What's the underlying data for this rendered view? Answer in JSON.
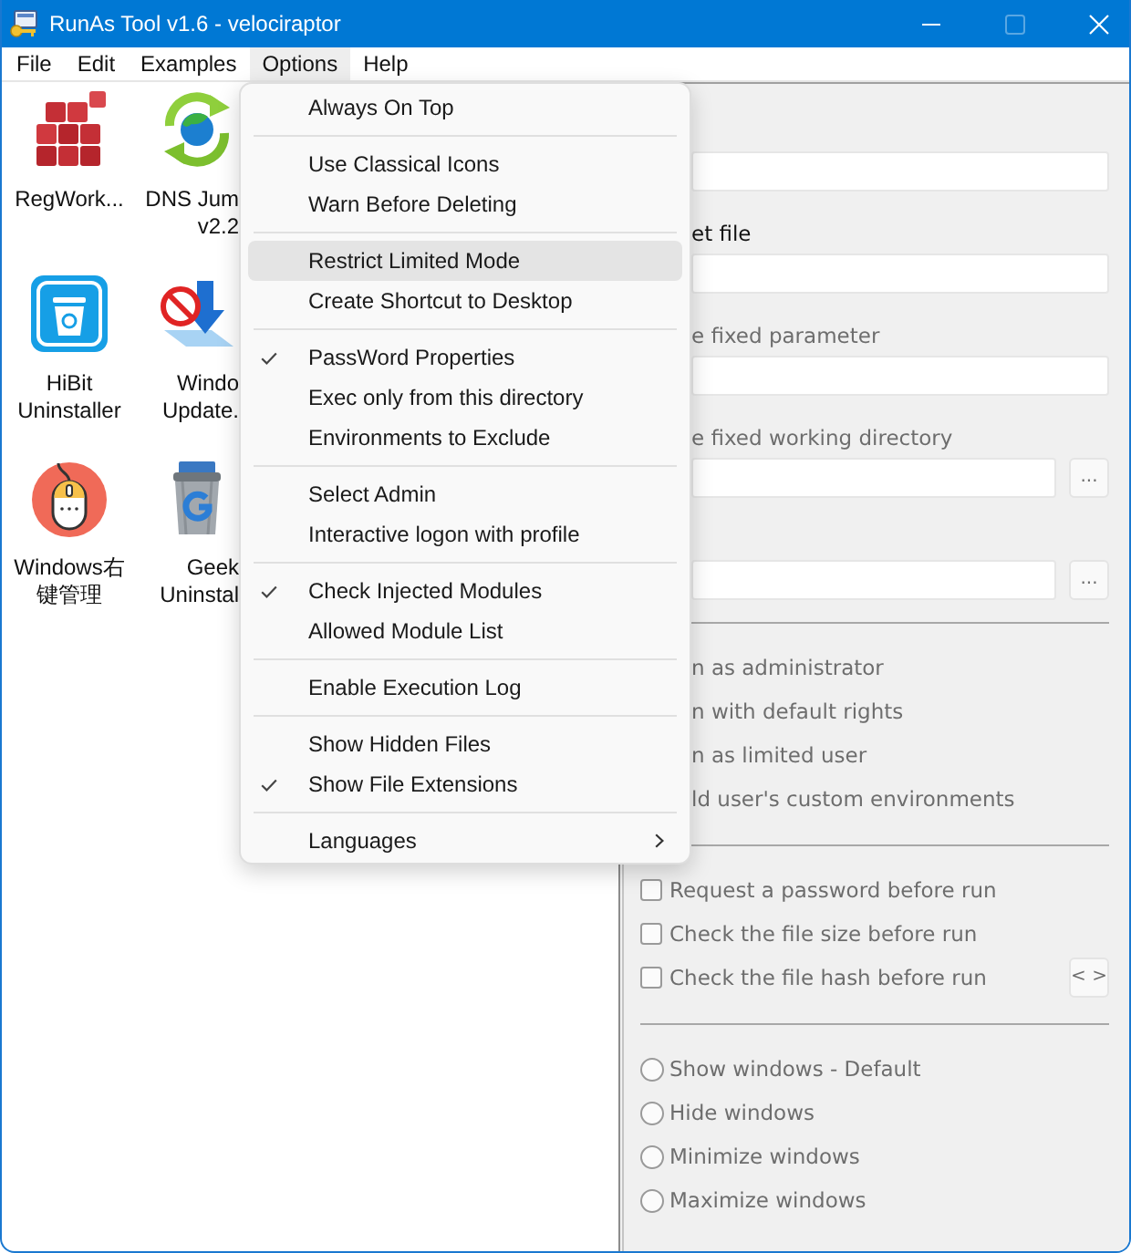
{
  "window": {
    "title": "RunAs Tool v1.6 - velociraptor",
    "maximize_enabled": false
  },
  "menu_bar": [
    {
      "label": "File",
      "selected": false
    },
    {
      "label": "Edit",
      "selected": false
    },
    {
      "label": "Examples",
      "selected": false
    },
    {
      "label": "Options",
      "selected": true
    },
    {
      "label": "Help",
      "selected": false
    }
  ],
  "desktop_items": [
    {
      "kind": "cubes",
      "label": [
        "RegWork..."
      ]
    },
    {
      "kind": "globe_arrows",
      "label": [
        "DNS Jum",
        "v2.2"
      ]
    },
    {
      "kind": "trash_tile",
      "label": [
        "HiBit",
        "Uninstaller"
      ]
    },
    {
      "kind": "prohibited_arrow",
      "label": [
        "Windo",
        "Update."
      ]
    },
    {
      "kind": "mouse",
      "label": [
        "Windows右",
        "键管理"
      ]
    },
    {
      "kind": "trash_can",
      "label": [
        "Geek",
        "Uninstal"
      ]
    }
  ],
  "options_menu": {
    "groups": [
      {
        "items": [
          {
            "label": "Always On Top",
            "kind": "command",
            "checked": false,
            "highlighted": false
          }
        ]
      },
      {
        "items": [
          {
            "label": "Use Classical Icons",
            "kind": "command",
            "checked": false,
            "highlighted": false
          },
          {
            "label": "Warn Before Deleting",
            "kind": "command",
            "checked": false,
            "highlighted": false
          }
        ]
      },
      {
        "items": [
          {
            "label": "Restrict Limited Mode",
            "kind": "command",
            "checked": false,
            "highlighted": true
          },
          {
            "label": "Create Shortcut to Desktop",
            "kind": "command",
            "checked": false,
            "highlighted": false
          }
        ]
      },
      {
        "items": [
          {
            "label": "PassWord Properties",
            "kind": "command",
            "checked": true,
            "highlighted": false
          },
          {
            "label": "Exec only from this directory",
            "kind": "command",
            "checked": false,
            "highlighted": false
          },
          {
            "label": "Environments to Exclude",
            "kind": "command",
            "checked": false,
            "highlighted": false
          }
        ]
      },
      {
        "items": [
          {
            "label": "Select Admin",
            "kind": "command",
            "checked": false,
            "highlighted": false
          },
          {
            "label": "Interactive logon with profile",
            "kind": "command",
            "checked": false,
            "highlighted": false
          }
        ]
      },
      {
        "items": [
          {
            "label": "Check Injected Modules",
            "kind": "command",
            "checked": true,
            "highlighted": false
          },
          {
            "label": "Allowed Module List",
            "kind": "command",
            "checked": false,
            "highlighted": false
          }
        ]
      },
      {
        "items": [
          {
            "label": "Enable Execution Log",
            "kind": "command",
            "checked": false,
            "highlighted": false
          }
        ]
      },
      {
        "items": [
          {
            "label": "Show Hidden Files",
            "kind": "command",
            "checked": false,
            "highlighted": false
          },
          {
            "label": "Show File Extensions",
            "kind": "command",
            "checked": true,
            "highlighted": false
          }
        ]
      },
      {
        "items": [
          {
            "label": "Languages",
            "kind": "submenu",
            "checked": false,
            "highlighted": false
          }
        ]
      }
    ]
  },
  "form": {
    "fields": [
      {
        "kind": "plain"
      },
      {
        "kind": "plain",
        "label": "et file",
        "label_disabled": false
      },
      {
        "kind": "plain",
        "label": "e fixed parameter",
        "label_disabled": true
      },
      {
        "kind": "browse",
        "label": "e fixed working directory",
        "label_disabled": true,
        "button": "..."
      },
      {
        "kind": "browse",
        "button": "..."
      }
    ]
  },
  "run_options": [
    {
      "text": "n as administrator",
      "disabled": true
    },
    {
      "text": "n with default rights",
      "disabled": true
    },
    {
      "text": "n as limited user",
      "disabled": true
    },
    {
      "text": "ld user's custom environments",
      "disabled": true
    }
  ],
  "checks": [
    {
      "text": "Request a password before run",
      "checked": false,
      "disabled": true
    },
    {
      "text": "Check the file size before run",
      "checked": false,
      "disabled": true
    },
    {
      "text": "Check the file hash before run",
      "checked": false,
      "disabled": true,
      "button": "< >"
    }
  ],
  "window_modes": [
    {
      "text": "Show windows - Default",
      "selected": false,
      "disabled": true
    },
    {
      "text": "Hide windows",
      "selected": false,
      "disabled": true
    },
    {
      "text": "Minimize windows",
      "selected": false,
      "disabled": true
    },
    {
      "text": "Maximize windows",
      "selected": false,
      "disabled": true
    }
  ]
}
